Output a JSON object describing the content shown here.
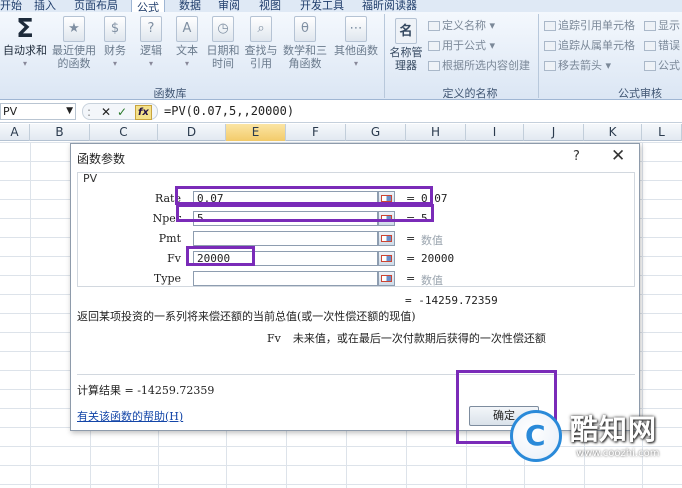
{
  "ribbon_tabs": [
    "开始",
    "插入",
    "页面布局",
    "公式",
    "数据",
    "审阅",
    "视图",
    "开发工具",
    "福昕阅读器"
  ],
  "ribbon": {
    "autosum": "自动求和",
    "buttons": [
      {
        "label": "最近使用的函数",
        "icon": "star"
      },
      {
        "label": "财务",
        "icon": "$"
      },
      {
        "label": "逻辑",
        "icon": "?"
      },
      {
        "label": "文本",
        "icon": "A"
      },
      {
        "label": "日期和时间",
        "icon": "clock"
      },
      {
        "label": "查找与引用",
        "icon": "search"
      },
      {
        "label": "数学和三角函数",
        "icon": "θ"
      },
      {
        "label": "其他函数",
        "icon": "more"
      }
    ],
    "group_function_library": "函数库",
    "name_manager": "名称管理器",
    "define_name": "定义名称",
    "use_in_formula": "用于公式",
    "create_from_selection": "根据所选内容创建",
    "group_defined_names": "定义的名称",
    "trace_precedents": "追踪引用单元格",
    "trace_dependents": "追踪从属单元格",
    "remove_arrows": "移去箭头",
    "show": "显示",
    "error": "错误",
    "formula": "公式",
    "group_formula_auditing": "公式审核"
  },
  "name_box": "PV",
  "formula_text": "=PV(0.07,5,,20000)",
  "columns": [
    "A",
    "B",
    "C",
    "D",
    "E",
    "F",
    "G",
    "H",
    "I",
    "J",
    "K",
    "L"
  ],
  "selected_column": "E",
  "dialog": {
    "title": "函数参数",
    "help_glyph": "?",
    "close_glyph": "✕",
    "function_name": "PV",
    "args": [
      {
        "label": "Rate",
        "value": "0.07",
        "result": "0.07"
      },
      {
        "label": "Nper",
        "value": "5",
        "result": "5"
      },
      {
        "label": "Pmt",
        "value": "",
        "result": "数值"
      },
      {
        "label": "Fv",
        "value": "20000",
        "result": "20000"
      },
      {
        "label": "Type",
        "value": "",
        "result": "数值"
      }
    ],
    "equals": "=",
    "result_line": "= -14259.72359",
    "description": "返回某项投资的一系列将来偿还额的当前总值(或一次性偿还额的现值)",
    "param_name": "Fv",
    "param_desc": "未来值，或在最后一次付款期后获得的一次性偿还额",
    "calc_result": "计算结果 = -14259.72359",
    "help_link": "有关该函数的帮助(H)",
    "ok_label": "确定"
  },
  "watermark": {
    "logo_letter": "C",
    "brand": "酷知网",
    "url": "www.coozhi.com"
  },
  "colors": {
    "highlight": "#7a2bb8",
    "accent": "#2a8ad9",
    "link": "#1446a8"
  }
}
